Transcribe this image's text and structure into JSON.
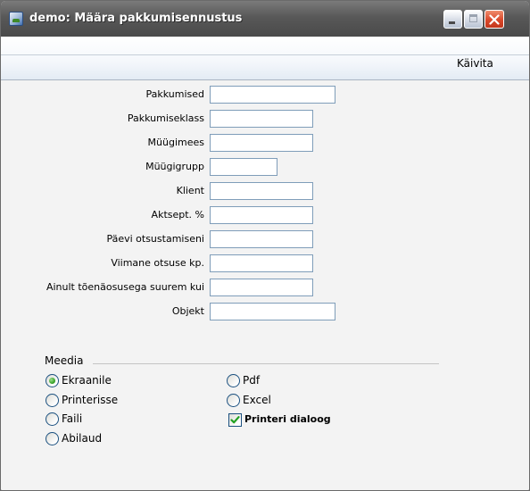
{
  "window": {
    "title": "demo: Määra pakkumisennustus",
    "icons": {
      "app": "app-icon",
      "minimize": "minimize-icon",
      "maximize": "maximize-icon",
      "close": "close-icon"
    }
  },
  "toolbar": {
    "run_label": "Käivita"
  },
  "form": {
    "fields": [
      {
        "label": "Pakkumised",
        "value": ""
      },
      {
        "label": "Pakkumiseklass",
        "value": ""
      },
      {
        "label": "Müügimees",
        "value": ""
      },
      {
        "label": "Müügigrupp",
        "value": ""
      },
      {
        "label": "Klient",
        "value": ""
      },
      {
        "label": "Aktsept. %",
        "value": ""
      },
      {
        "label": "Päevi otsustamiseni",
        "value": ""
      },
      {
        "label": "Viimane otsuse kp.",
        "value": ""
      },
      {
        "label": "Ainult tõenäosusega suurem kui",
        "value": ""
      },
      {
        "label": "Objekt",
        "value": ""
      }
    ]
  },
  "media": {
    "label": "Meedia",
    "selected": "Ekraanile",
    "options": [
      {
        "label": "Ekraanile",
        "checked": true
      },
      {
        "label": "Printerisse",
        "checked": false
      },
      {
        "label": "Faili",
        "checked": false
      },
      {
        "label": "Abilaud",
        "checked": false
      },
      {
        "label": "Pdf",
        "checked": false
      },
      {
        "label": "Excel",
        "checked": false
      }
    ],
    "printer_dialog": {
      "label": "Printeri dialoog",
      "checked": true
    }
  }
}
